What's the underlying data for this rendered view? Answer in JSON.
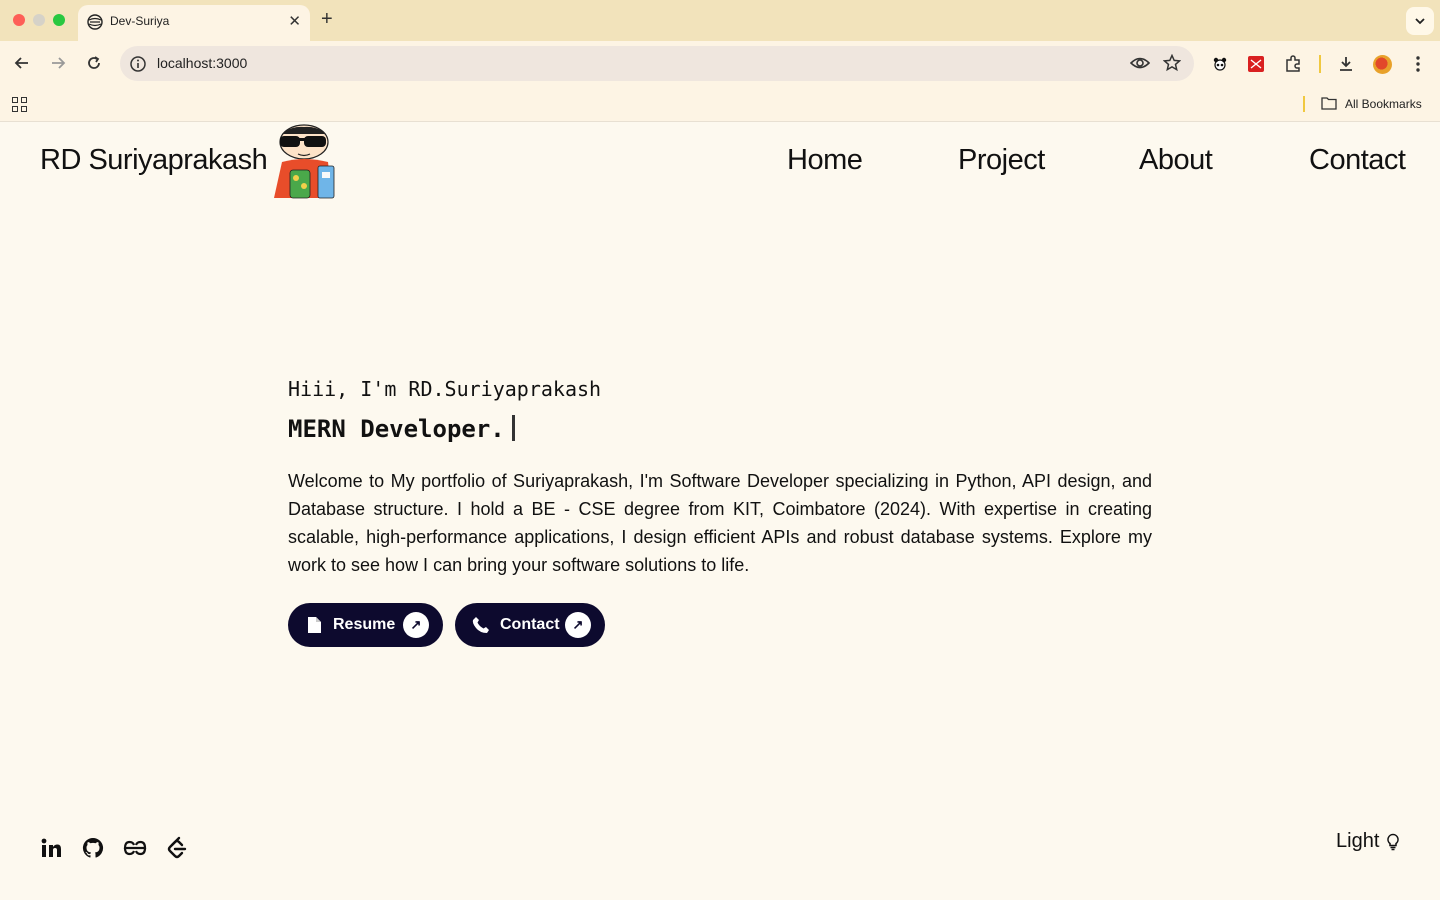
{
  "browser": {
    "tab_title": "Dev-Suriya",
    "url": "localhost:3000",
    "bookmarks_label": "All Bookmarks"
  },
  "header": {
    "logo_text": "RD Suriyaprakash",
    "nav": [
      {
        "label": "Home"
      },
      {
        "label": "Project"
      },
      {
        "label": "About"
      },
      {
        "label": "Contact"
      }
    ]
  },
  "hero": {
    "greeting": "Hiii, I'm RD.Suriyaprakash",
    "role": "MERN Developer.",
    "intro": "Welcome to My portfolio of Suriyaprakash, I'm Software Developer specializing in Python, API design, and Database structure. I hold a BE - CSE degree from KIT, Coimbatore (2024). With expertise in creating scalable, high-performance applications, I design efficient APIs and robust database systems. Explore my work to see how I can bring your software solutions to life.",
    "buttons": {
      "resume": "Resume",
      "contact": "Contact"
    }
  },
  "footer": {
    "theme_label": "Light",
    "socials": [
      "linkedin-icon",
      "github-icon",
      "geeksforgeeks-icon",
      "leetcode-icon"
    ]
  },
  "colors": {
    "page_bg": "#fdf9ef",
    "button_bg": "#0d0a2e",
    "tab_strip": "#f2e3bb"
  }
}
